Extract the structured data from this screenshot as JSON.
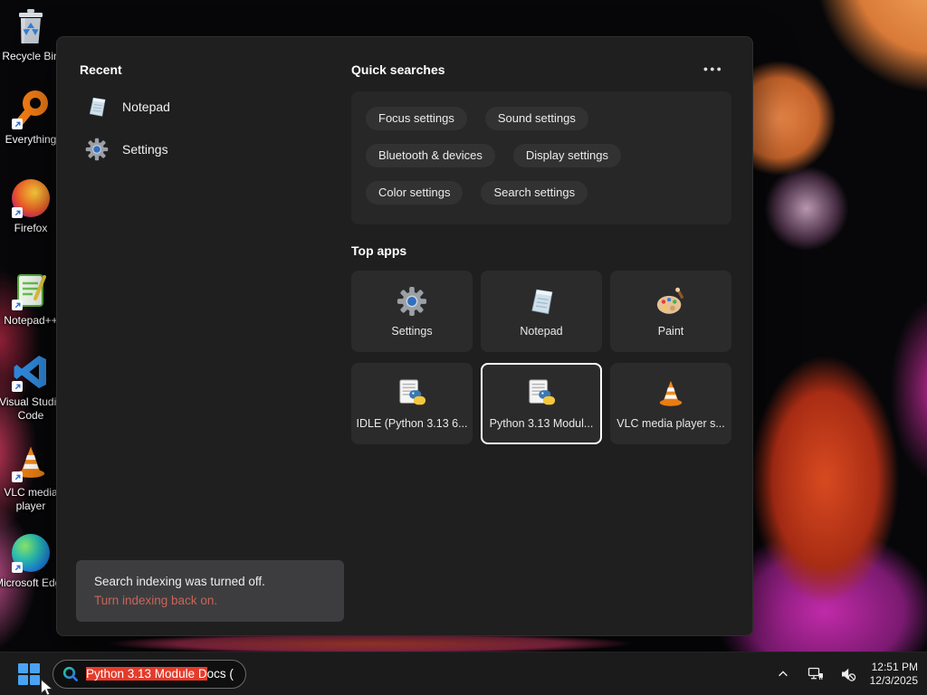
{
  "colors": {
    "panel_bg": "#1f1f1f",
    "card_bg": "#272727",
    "pill_bg": "#323232",
    "tile_bg": "#2b2b2b",
    "taskbar_bg": "#1b1b1c",
    "selection_highlight": "#e53b2a",
    "indexing_link": "#c9655a",
    "accent_blue": "#4aa3f2"
  },
  "desktop": {
    "icons": [
      {
        "label": "Recycle Bin",
        "icon": "recycle-bin-icon"
      },
      {
        "label": "Everything",
        "icon": "everything-icon"
      },
      {
        "label": "Firefox",
        "icon": "firefox-icon"
      },
      {
        "label": "Notepad++",
        "icon": "notepadpp-icon"
      },
      {
        "label": "Visual Studio Code",
        "icon": "vscode-icon"
      },
      {
        "label": "VLC media player",
        "icon": "vlc-icon"
      },
      {
        "label": "Microsoft Edge",
        "icon": "edge-icon"
      }
    ]
  },
  "search_panel": {
    "recent": {
      "title": "Recent",
      "items": [
        {
          "label": "Notepad",
          "icon": "notepad-icon"
        },
        {
          "label": "Settings",
          "icon": "settings-gear-icon"
        }
      ]
    },
    "quick_searches": {
      "title": "Quick searches",
      "more_label": "●●●",
      "pills": [
        "Focus settings",
        "Sound settings",
        "Bluetooth & devices",
        "Display settings",
        "Color settings",
        "Search settings"
      ]
    },
    "top_apps": {
      "title": "Top apps",
      "tiles": [
        {
          "label": "Settings",
          "icon": "settings-gear-icon",
          "selected": false
        },
        {
          "label": "Notepad",
          "icon": "notepad-icon",
          "selected": false
        },
        {
          "label": "Paint",
          "icon": "paint-icon",
          "selected": false
        },
        {
          "label": "IDLE (Python 3.13 6...",
          "icon": "python-doc-icon",
          "selected": false
        },
        {
          "label": "Python 3.13 Modul...",
          "icon": "python-doc-icon",
          "selected": true
        },
        {
          "label": "VLC media player s...",
          "icon": "vlc-icon",
          "selected": false
        }
      ]
    },
    "notice": {
      "message": "Search indexing was turned off.",
      "link": "Turn indexing back on."
    }
  },
  "taskbar": {
    "search": {
      "highlighted_text": "Python 3.13 Module D",
      "rest_text": "ocs (",
      "full_value": "Python 3.13 Module Docs ("
    },
    "tray": {
      "time": "12:51 PM",
      "date": "12/3/2025"
    }
  }
}
